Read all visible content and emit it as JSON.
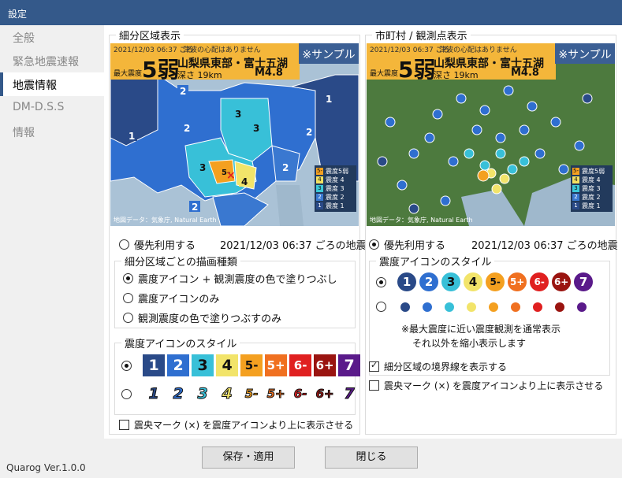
{
  "window": {
    "title": "設定"
  },
  "sidebar": {
    "items": [
      {
        "label": "全般"
      },
      {
        "label": "緊急地震速報"
      },
      {
        "label": "地震情報"
      },
      {
        "label": "DM-D.S.S"
      },
      {
        "label": "情報"
      }
    ],
    "active_index": 2
  },
  "left": {
    "title": "細分区域表示",
    "header": {
      "time": "2021/12/03 06:37 ごろ",
      "tsunami": "津波の心配はありません",
      "max_label": "最大震度",
      "max_value": "5弱",
      "place": "山梨県東部・富士五湖",
      "depth": "深さ 19km",
      "mag": "M4.8"
    },
    "sample": "※サンプル",
    "credit": "地図データ：気象庁, Natural Earth",
    "legend": [
      {
        "tag": "5-",
        "label": "震度5弱",
        "color": "#f4a020"
      },
      {
        "tag": "4",
        "label": "震度 4",
        "color": "#f4e060"
      },
      {
        "tag": "3",
        "label": "震度 3",
        "color": "#3cc8d8"
      },
      {
        "tag": "2",
        "label": "震度 2",
        "color": "#3a78d0"
      },
      {
        "tag": "1",
        "label": "震度 1",
        "color": "#2a4a88"
      }
    ],
    "priority_label": "優先利用する",
    "caption": "2021/12/03 06:37 ごろの地震",
    "draw_title": "細分区域ごとの描画種類",
    "draw_options": [
      "震度アイコン + 観測震度の色で塗りつぶし",
      "震度アイコンのみ",
      "観測震度の色で塗りつぶすのみ"
    ],
    "icon_style_title": "震度アイコンのスタイル",
    "icons": [
      "1",
      "2",
      "3",
      "4",
      "5-",
      "5+",
      "6-",
      "6+",
      "7"
    ],
    "epicenter_label": "震央マーク (×) を震度アイコンより上に表示させる"
  },
  "right": {
    "title": "市町村 / 観測点表示",
    "priority_label": "優先利用する",
    "caption": "2021/12/03 06:37 ごろの地震",
    "icon_style_title": "震度アイコンのスタイル",
    "icons": [
      "1",
      "2",
      "3",
      "4",
      "5-",
      "5+",
      "6-",
      "6+",
      "7"
    ],
    "note1": "※最大震度に近い震度観測を通常表示",
    "note2": "それ以外を縮小表示します",
    "boundary_label": "細分区域の境界線を表示する",
    "epicenter_label": "震央マーク (×) を震度アイコンより上に表示させる"
  },
  "colors": {
    "i1": "#2a4a88",
    "i2": "#2f6fd0",
    "i3": "#38c0d8",
    "i4": "#f2e46a",
    "i5m": "#f4a020",
    "i5p": "#f07020",
    "i6m": "#e02020",
    "i6p": "#9a1410",
    "i7": "#5a1a8a"
  },
  "footer": {
    "save": "保存・適用",
    "close": "閉じる",
    "version": "Quarog Ver.1.0.0"
  }
}
